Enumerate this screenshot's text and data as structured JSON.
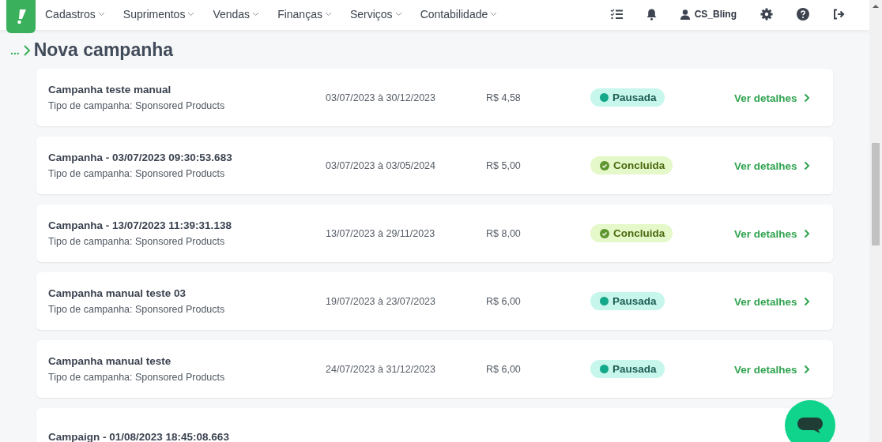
{
  "nav": {
    "menus": [
      {
        "label": "Cadastros"
      },
      {
        "label": "Suprimentos"
      },
      {
        "label": "Vendas"
      },
      {
        "label": "Finanças"
      },
      {
        "label": "Serviços"
      },
      {
        "label": "Contabilidade"
      }
    ],
    "user": "CS_Bling"
  },
  "breadcrumb": {
    "ellipsis": "...",
    "title": "Nova campanha"
  },
  "campaigns": [
    {
      "name": "Campanha teste manual",
      "type": "Tipo de campanha: Sponsored Products",
      "period": "03/07/2023 à 30/12/2023",
      "budget": "R$ 4,58",
      "status": {
        "kind": "paused",
        "label": "Pausada"
      },
      "link": "Ver detalhes"
    },
    {
      "name": "Campanha - 03/07/2023 09:30:53.683",
      "type": "Tipo de campanha: Sponsored Products",
      "period": "03/07/2023 à 03/05/2024",
      "budget": "R$ 5,00",
      "status": {
        "kind": "done",
        "label": "Concluida"
      },
      "link": "Ver detalhes"
    },
    {
      "name": "Campanha - 13/07/2023 11:39:31.138",
      "type": "Tipo de campanha: Sponsored Products",
      "period": "13/07/2023 à 29/11/2023",
      "budget": "R$ 8,00",
      "status": {
        "kind": "done",
        "label": "Concluida"
      },
      "link": "Ver detalhes"
    },
    {
      "name": "Campanha manual teste 03",
      "type": "Tipo de campanha: Sponsored Products",
      "period": "19/07/2023 à 23/07/2023",
      "budget": "R$ 6,00",
      "status": {
        "kind": "paused",
        "label": "Pausada"
      },
      "link": "Ver detalhes"
    },
    {
      "name": "Campanha manual teste",
      "type": "Tipo de campanha: Sponsored Products",
      "period": "24/07/2023 à 31/12/2023",
      "budget": "R$ 6,00",
      "status": {
        "kind": "paused",
        "label": "Pausada"
      },
      "link": "Ver detalhes"
    },
    {
      "name": "Campaign - 01/08/2023 18:45:08.663"
    }
  ]
}
